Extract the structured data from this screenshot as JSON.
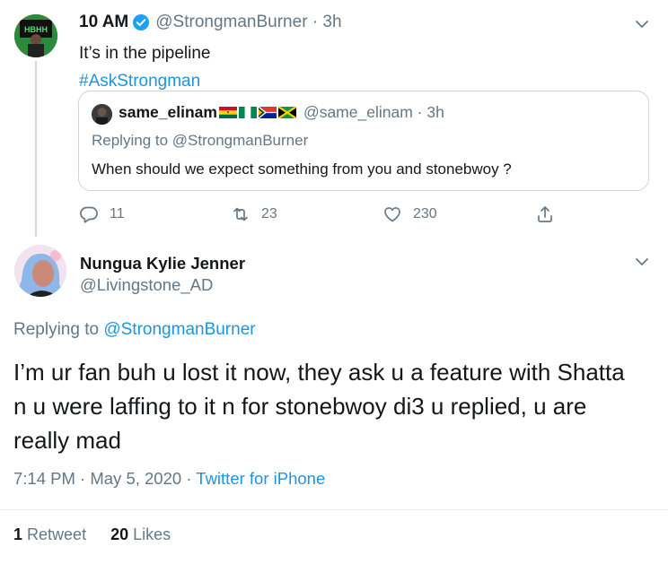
{
  "parent_tweet": {
    "display_name": "10 AM",
    "handle": "@StrongmanBurner",
    "time": "3h",
    "text": "It’s in the pipeline",
    "hashtag": "#AskStrongman",
    "quoted": {
      "display_name": "same_elinam",
      "flags": [
        "ghana-flag",
        "nigeria-flag",
        "south-africa-flag",
        "jamaica-flag"
      ],
      "handle": "@same_elinam",
      "time": "3h",
      "replying_prefix": "Replying to",
      "replying_to": "@StrongmanBurner",
      "text": "When should we expect something from you and stonebwoy ?"
    },
    "actions": {
      "replies": "11",
      "retweets": "23",
      "likes": "230"
    }
  },
  "main_tweet": {
    "display_name": "Nungua Kylie Jenner",
    "handle": "@Livingstone_AD",
    "replying_prefix": "Replying to",
    "replying_to": "@StrongmanBurner",
    "text": "I’m ur fan buh u lost it now, they ask u a feature with Shatta n u were laffing to it n for stonebwoy di3 u replied, u are really mad",
    "time": "7:14 PM",
    "date": "May 5, 2020",
    "source": "Twitter for iPhone",
    "retweet_count": "1",
    "retweet_label": "Retweet",
    "like_count": "20",
    "like_label": "Likes"
  },
  "colors": {
    "link": "#1b95e0",
    "muted": "#657786",
    "text": "#14171a",
    "border": "#ccd6dd"
  }
}
